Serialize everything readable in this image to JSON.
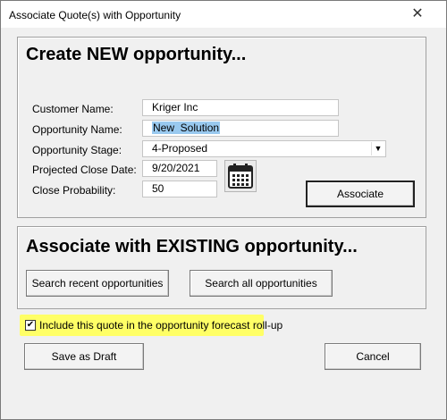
{
  "window": {
    "title": "Associate Quote(s) with Opportunity",
    "close_symbol": "✕"
  },
  "new_opportunity": {
    "heading": "Create NEW opportunity...",
    "customer_name_label": "Customer Name:",
    "customer_name_value": "Kriger Inc",
    "opportunity_name_label": "Opportunity Name:",
    "opportunity_name_value": "New  Solution",
    "opportunity_stage_label": "Opportunity Stage:",
    "opportunity_stage_value": "4-Proposed",
    "projected_close_date_label": "Projected Close Date:",
    "projected_close_date_value": "9/20/2021",
    "close_probability_label": "Close Probability:",
    "close_probability_value": "50",
    "associate_button": "Associate",
    "calendar_icon": "calendar-icon"
  },
  "existing_opportunity": {
    "heading": "Associate with EXISTING opportunity...",
    "search_recent_button": "Search recent opportunities",
    "search_all_button": "Search all opportunities"
  },
  "forecast_checkbox": {
    "checked": true,
    "check_symbol": "✔",
    "label": "Include this quote in the opportunity forecast roll-up",
    "highlight_color": "#ffff66"
  },
  "footer": {
    "save_draft_button": "Save as Draft",
    "cancel_button": "Cancel"
  }
}
